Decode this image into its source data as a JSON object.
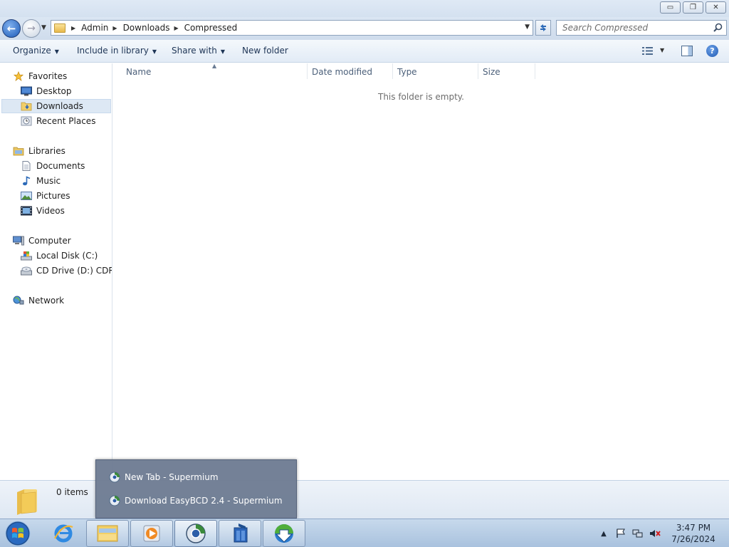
{
  "window": {
    "minimize_glyph": "▭",
    "maximize_glyph": "❐",
    "close_glyph": "✕"
  },
  "address_bar": {
    "breadcrumbs": [
      "Admin",
      "Downloads",
      "Compressed"
    ],
    "search_placeholder": "Search Compressed"
  },
  "toolbar": {
    "organize": "Organize",
    "include_in_library": "Include in library",
    "share_with": "Share with",
    "new_folder": "New folder"
  },
  "nav_pane": {
    "favorites_header": "Favorites",
    "favorites": [
      "Desktop",
      "Downloads",
      "Recent Places"
    ],
    "selected": "Downloads",
    "libraries_header": "Libraries",
    "libraries": [
      "Documents",
      "Music",
      "Pictures",
      "Videos"
    ],
    "computer_header": "Computer",
    "drives": [
      "Local Disk (C:)",
      "CD Drive (D:) CDROM"
    ],
    "network_header": "Network"
  },
  "file_list": {
    "columns": [
      "Name",
      "Date modified",
      "Type",
      "Size"
    ],
    "empty_message": "This folder is empty."
  },
  "details_pane": {
    "item_count": "0 items"
  },
  "jump_list": {
    "items": [
      "New Tab - Supermium",
      "Download EasyBCD 2.4 - Supermium"
    ]
  },
  "taskbar": {
    "apps": [
      "internet-explorer",
      "windows-explorer",
      "media-player",
      "supermium",
      "setup-installer",
      "download-manager"
    ],
    "active_app": "supermium"
  },
  "system_tray": {
    "time": "3:47 PM",
    "date": "7/26/2024",
    "show_hidden_glyph": "▲"
  },
  "colors": {
    "accent": "#1f59b3",
    "selection": "#dde8f4",
    "jumplist_bg": "#6e7c93"
  }
}
